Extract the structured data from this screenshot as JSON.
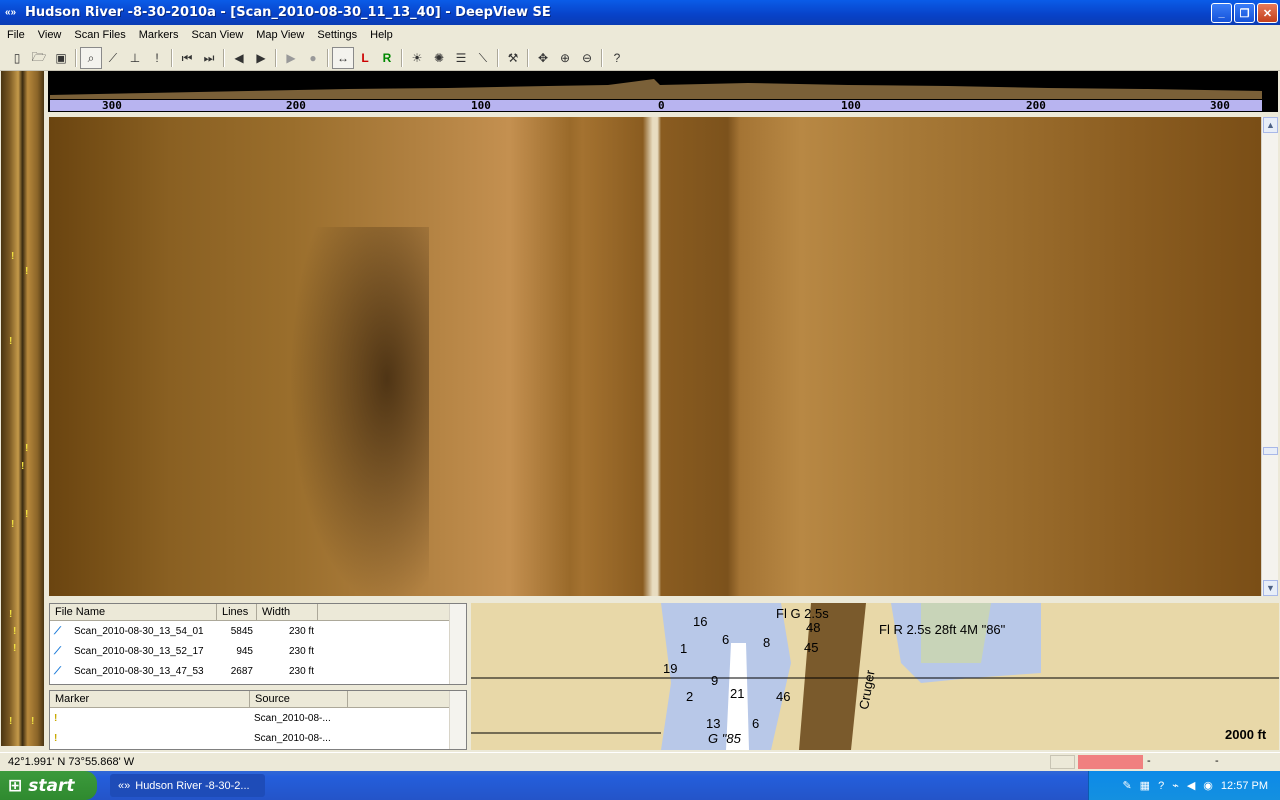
{
  "window": {
    "title": "Hudson River -8-30-2010a - [Scan_2010-08-30_11_13_40] - DeepView SE"
  },
  "menu": [
    "File",
    "View",
    "Scan Files",
    "Markers",
    "Scan View",
    "Map View",
    "Settings",
    "Help"
  ],
  "ruler": {
    "labels": [
      "300",
      "200",
      "100",
      "0",
      "100",
      "200",
      "300"
    ]
  },
  "files": {
    "headers": [
      "File Name",
      "Lines",
      "Width"
    ],
    "rows": [
      {
        "name": "Scan_2010-08-30_13_54_01",
        "lines": "5845",
        "width": "230 ft"
      },
      {
        "name": "Scan_2010-08-30_13_52_17",
        "lines": "945",
        "width": "230 ft"
      },
      {
        "name": "Scan_2010-08-30_13_47_53",
        "lines": "2687",
        "width": "230 ft"
      }
    ]
  },
  "markers": {
    "headers": [
      "Marker",
      "Source"
    ],
    "rows": [
      {
        "source": "Scan_2010-08-..."
      },
      {
        "source": "Scan_2010-08-..."
      }
    ]
  },
  "map": {
    "labels": [
      "Fl G 2.5s",
      "48",
      "45",
      "16",
      "6",
      "8",
      "19",
      "1",
      "9",
      "21",
      "46",
      "2",
      "13",
      "6",
      "G \"85",
      "Fl R 2.5s 28ft 4M \"86\"",
      "Cruger"
    ],
    "scale": "2000 ft"
  },
  "status": {
    "coords": "42°1.991' N 73°55.868' W",
    "segment1": "-",
    "segment2": "-"
  },
  "taskbar": {
    "start": "start",
    "task": "Hudson River -8-30-2...",
    "clock": "12:57 PM"
  },
  "colors": {
    "title_bar": "#0842c8",
    "ruler_strip": "#b8b4f0",
    "sonar_mid": "#9a6e2c",
    "status_highlight": "#f08080"
  }
}
